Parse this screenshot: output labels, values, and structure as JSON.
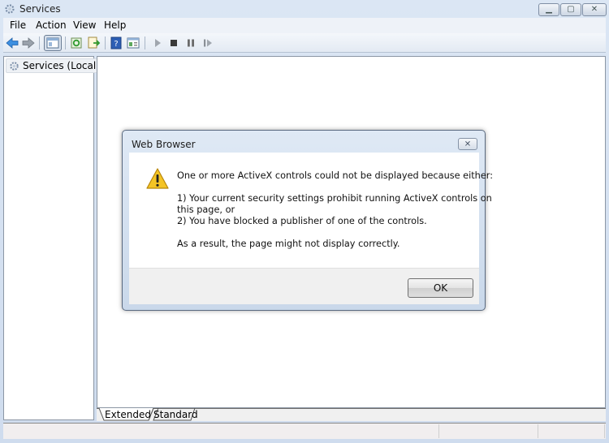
{
  "window": {
    "title": "Services",
    "controls": {
      "minimize": "minimize",
      "maximize": "maximize",
      "close": "close"
    }
  },
  "menu": [
    "File",
    "Action",
    "View",
    "Help"
  ],
  "toolbar": {
    "buttons": [
      "back-arrow-icon",
      "forward-arrow-icon",
      "show-hide-console-tree-icon",
      "refresh-icon",
      "export-list-icon",
      "help-icon",
      "properties-icon",
      "start-service-icon",
      "stop-service-icon",
      "pause-service-icon",
      "restart-service-icon"
    ]
  },
  "tree": {
    "selected_item": "Services (Local)"
  },
  "tabs": [
    "Extended",
    "Standard"
  ],
  "dialog": {
    "title": "Web Browser",
    "icon": "warning-icon",
    "lines": [
      "One or more ActiveX controls could not be displayed because either:",
      "1) Your current security settings prohibit running ActiveX controls on",
      "this page, or",
      "2) You have blocked a publisher of one of the controls.",
      "As a result, the page might not display correctly."
    ],
    "ok_label": "OK"
  }
}
